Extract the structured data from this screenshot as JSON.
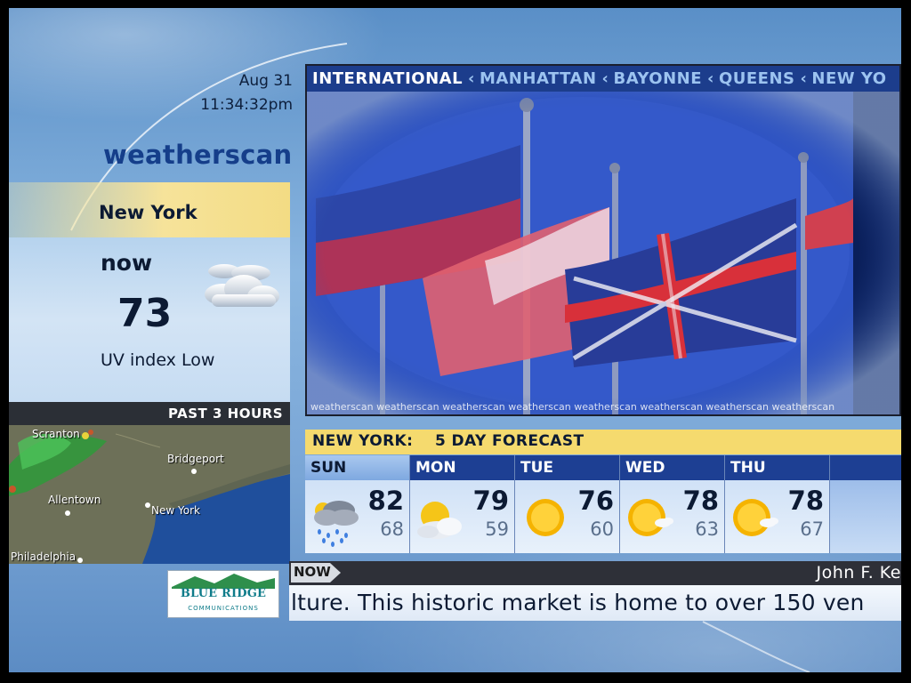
{
  "clock": {
    "date": "Aug 31",
    "time": "11:34:32pm"
  },
  "brand": "weatherscan",
  "current": {
    "location": "New York",
    "label": "now",
    "temp": "73",
    "uv": "UV index Low",
    "icon": "partly-cloudy-night-icon"
  },
  "radar": {
    "title": "PAST 3 HOURS",
    "cities": [
      "Scranton",
      "Bridgeport",
      "Allentown",
      "New York",
      "Philadelphia"
    ]
  },
  "video": {
    "locations": [
      "INTERNATIONAL",
      "MANHATTAN",
      "BAYONNE",
      "QUEENS",
      "NEW YO"
    ],
    "watermark": "weatherscan weatherscan weatherscan weatherscan weatherscan weatherscan weatherscan weatherscan"
  },
  "forecast": {
    "title": "NEW YORK:",
    "subtitle": "5 DAY FORECAST",
    "days": [
      {
        "day": "SUN",
        "hi": "82",
        "lo": "68",
        "icon": "rain-cloud-icon"
      },
      {
        "day": "MON",
        "hi": "79",
        "lo": "59",
        "icon": "partly-cloudy-icon"
      },
      {
        "day": "TUE",
        "hi": "76",
        "lo": "60",
        "icon": "sunny-icon"
      },
      {
        "day": "WED",
        "hi": "78",
        "lo": "63",
        "icon": "mostly-sunny-icon"
      },
      {
        "day": "THU",
        "hi": "78",
        "lo": "67",
        "icon": "mostly-sunny-icon"
      }
    ]
  },
  "ticker": {
    "tag": "NOW",
    "location": "John F. Ke",
    "text": "lture. This historic market is home to over 150 ven"
  },
  "sponsor": {
    "name": "BLUE RIDGE",
    "sub": "COMMUNICATIONS"
  }
}
